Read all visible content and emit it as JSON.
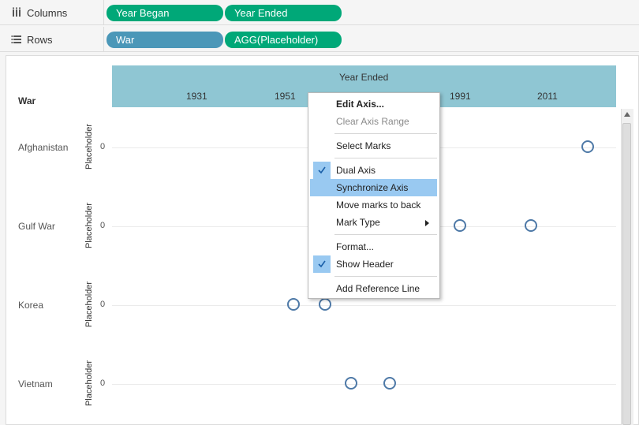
{
  "shelves": {
    "columns": {
      "label": "Columns",
      "pills": [
        "Year Began",
        "Year Ended"
      ]
    },
    "rows": {
      "label": "Rows",
      "pills": [
        "War",
        "AGG(Placeholder)"
      ]
    }
  },
  "view": {
    "header_title": "Year Ended",
    "row_dimension": "War",
    "ticks": [
      "1931",
      "1951",
      "1991",
      "2011"
    ],
    "axis_title": "Placeholder",
    "zero_label": "0",
    "rows": [
      {
        "label": "Afghanistan"
      },
      {
        "label": "Gulf War"
      },
      {
        "label": "Korea"
      },
      {
        "label": "Vietnam"
      }
    ],
    "mark_color": "#4e79a7",
    "header_color": "#8fc6d3"
  },
  "context_menu": {
    "items": [
      {
        "label": "Edit Axis..."
      },
      {
        "label": "Clear Axis Range"
      },
      {
        "label": "Select Marks"
      },
      {
        "label": "Dual Axis"
      },
      {
        "label": "Synchronize Axis"
      },
      {
        "label": "Move marks to back"
      },
      {
        "label": "Mark Type"
      },
      {
        "label": "Format..."
      },
      {
        "label": "Show Header"
      },
      {
        "label": "Add Reference Line"
      }
    ]
  }
}
